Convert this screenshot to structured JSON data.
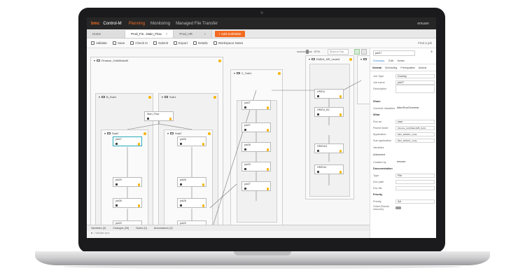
{
  "app": {
    "brand_mark": "bmc",
    "brand_name": "Control-M",
    "nav": [
      "Planning",
      "Monitoring",
      "Managed File Transfer"
    ],
    "user": "emuser"
  },
  "tabs": [
    {
      "label": "Home"
    },
    {
      "label": "Prod_Fin...Main_Flow"
    },
    {
      "label": "Prod_HR"
    }
  ],
  "add_subfolder_label": "+ Add Subfolder",
  "toolbar": {
    "items": [
      "Validate",
      "Save",
      "Check In",
      "Submit",
      "Export",
      "Details",
      "Workspace Notes"
    ],
    "search_label": "Find a job"
  },
  "canvas": {
    "zoom": "87%",
    "show_select": "Show in Cha"
  },
  "folders": {
    "main": "Finance_Grid/Main40",
    "b_sub1": "B_Sub1",
    "b_sub1_inner": "Sub2",
    "b_sub2": "Sub1",
    "b_sub2_inner": "Sub2",
    "c_sub1": "C_Sub1",
    "right": "EMEA_HR_Level4",
    "far_right": ""
  },
  "jobs": {
    "start": "Start_Flow",
    "a": "job27",
    "b": "job26",
    "c": "job29",
    "d": "job28",
    "e": "job29",
    "f": "job28",
    "g": "job28",
    "h": "job29",
    "i": "job27",
    "j": "job27",
    "k": "job28",
    "l": "job29",
    "m": "job27",
    "r1": "HR/EU",
    "r2": "HR/EU_B2",
    "r3": "HR/EU/3",
    "r4": "HR/EU4"
  },
  "bottom_tabs": [
    "Variables (0)",
    "Changes (26)",
    "Notes (0)",
    "Automations (0)"
  ],
  "status_text": "■ ○ Validate sync",
  "panel": {
    "job_title": "job27",
    "tabs1": [
      "Summary",
      "Edit",
      "Notes"
    ],
    "tabs2": [
      "General",
      "Scheduling",
      "Prerequisites",
      "Actions"
    ],
    "fields": [
      {
        "label": "Job Type",
        "value": "Dummy"
      },
      {
        "label": "Job name",
        "value": "job27"
      },
      {
        "label": "Description",
        "value": ""
      }
    ],
    "share_label": "Share",
    "share_fields": [
      {
        "label": "Override Variables",
        "value": "Alter/Run/Override"
      }
    ],
    "what_label": "What",
    "what_fields": [
      {
        "label": "Run as",
        "value": "user"
      },
      {
        "label": "Parent folder",
        "value": "Finance_Grid/Main40/B_Sub1"
      },
      {
        "label": "Application",
        "value": "DEV_MAINFL_Code"
      },
      {
        "label": "Sub application",
        "value": "DEV_MAINFL_Code"
      },
      {
        "label": "Variables",
        "value": ""
      }
    ],
    "advanced_label": "Advanced",
    "created_by": {
      "label": "Created by",
      "value": "emuser"
    },
    "documentation_label": "Documentation",
    "doc_fields": [
      {
        "label": "Type",
        "value": "File"
      },
      {
        "label": "Doc path",
        "value": ""
      },
      {
        "label": "Doc file",
        "value": ""
      }
    ],
    "priority_label": "Priority",
    "priority_field": {
      "label": "Priority",
      "value": "AA"
    },
    "critical_label": "Critical (Resolve resources)"
  }
}
